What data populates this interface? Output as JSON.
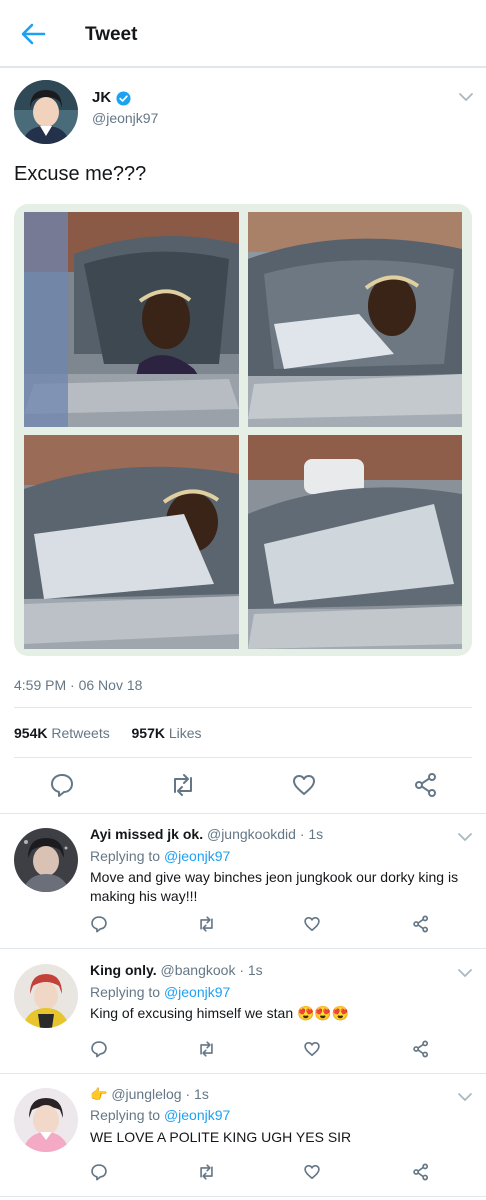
{
  "header": {
    "title": "Tweet",
    "back_icon": "back-arrow-icon"
  },
  "tweet": {
    "author_name": "JK",
    "author_handle": "@jeonjk97",
    "text": "Excuse me???",
    "timestamp": "4:59 PM · 06 Nov 18",
    "retweets_count": "954K",
    "retweets_label": "Retweets",
    "likes_count": "957K",
    "likes_label": "Likes"
  },
  "icons": {
    "reply": "reply-icon",
    "retweet": "retweet-icon",
    "like": "like-icon",
    "share": "share-icon",
    "more": "chevron-down-icon",
    "verified": "verified-badge-icon"
  },
  "colors": {
    "accent": "#1da1f2",
    "secondary_text": "#657786",
    "divider": "#e1e8ed",
    "icon_gray": "#657786"
  },
  "replies": [
    {
      "name": "Ayi missed jk ok.",
      "handle": "@jungkookdid",
      "time": "· 1s",
      "replying_prefix": "Replying to",
      "replying_to": "@jeonjk97",
      "text": "Move and give way binches jeon jungkook our dorky king is making his way!!!"
    },
    {
      "name": "King only.",
      "handle": "@bangkook",
      "time": "· 1s",
      "replying_prefix": "Replying to",
      "replying_to": "@jeonjk97",
      "text": "King of excusing himself we stan 😍😍😍"
    },
    {
      "name": "👉",
      "handle": "@junglelog",
      "time": "· 1s",
      "replying_prefix": "Replying to",
      "replying_to": "@jeonjk97",
      "text": "WE LOVE A POLITE KING UGH YES SIR"
    }
  ]
}
